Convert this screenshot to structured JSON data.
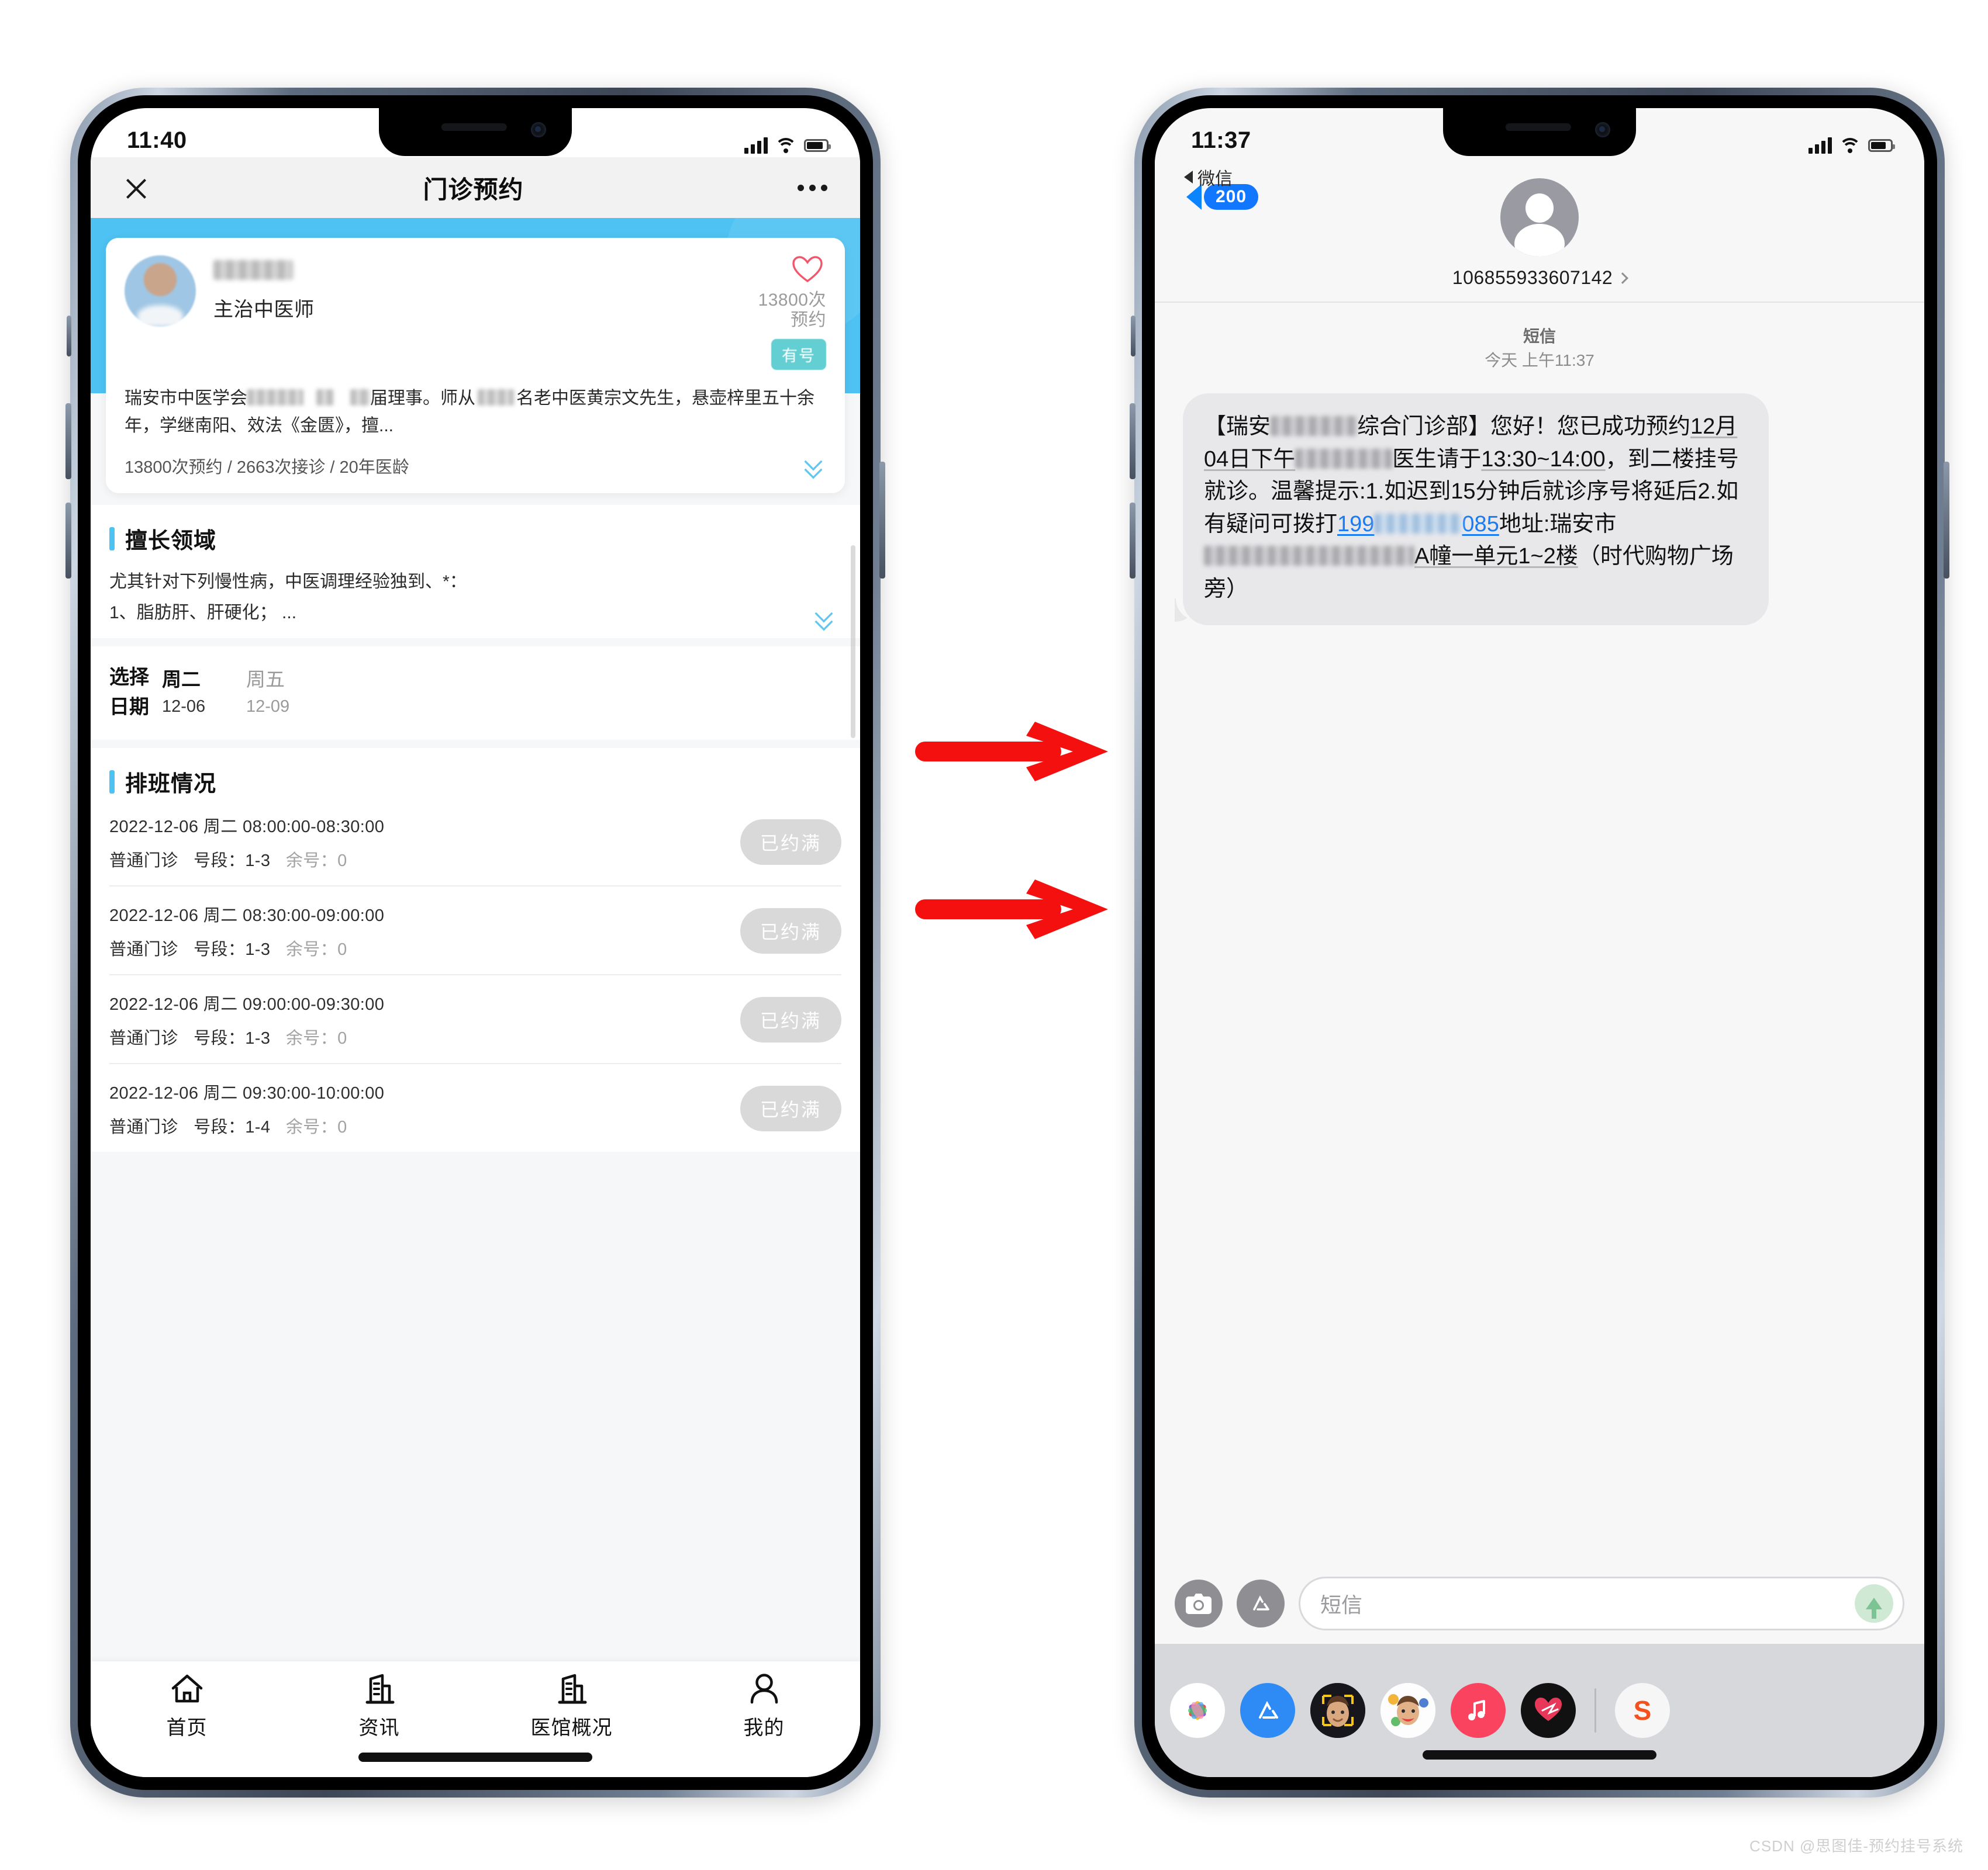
{
  "left_phone": {
    "status": {
      "time": "11:40"
    },
    "nav": {
      "title": "门诊预约",
      "close_icon": "close-icon",
      "more_icon": "more-dots-icon"
    },
    "doctor": {
      "name_masked": "",
      "rank": "主治中医师",
      "booking_count": "13800次",
      "booking_label": "预约",
      "badge": "有号",
      "favorite_icon": "heart-icon",
      "desc_p1": "瑞安市中医学会",
      "desc_p2": "届理事。师从",
      "desc_p3": "名老中医黄宗文先生，悬壶梓里五十余年，学继南阳、效法《金匮》，擅...",
      "stats": "13800次预约 / 2663次接诊 / 20年医龄",
      "expand_icon": "chevron-double-down-icon"
    },
    "expertise": {
      "title": "擅长领域",
      "line1": "尤其针对下列慢性病，中医调理经验独到、*：",
      "line2": "1、脂肪肝、肝硬化； ...",
      "expand_icon": "chevron-double-down-icon"
    },
    "date_picker": {
      "label_line1": "选择",
      "label_line2": "日期",
      "options": [
        {
          "weekday": "周二",
          "date": "12-06",
          "selected": true
        },
        {
          "weekday": "周五",
          "date": "12-09",
          "selected": false
        }
      ]
    },
    "schedule": {
      "title": "排班情况",
      "rows": [
        {
          "line1": "2022-12-06  周二   08:00:00-08:30:00",
          "clinic": "普通门诊",
          "range_label": "号段：",
          "range": "1-3",
          "left_label": "余号：",
          "left": "0",
          "status": "已约满"
        },
        {
          "line1": "2022-12-06  周二   08:30:00-09:00:00",
          "clinic": "普通门诊",
          "range_label": "号段：",
          "range": "1-3",
          "left_label": "余号：",
          "left": "0",
          "status": "已约满"
        },
        {
          "line1": "2022-12-06  周二   09:00:00-09:30:00",
          "clinic": "普通门诊",
          "range_label": "号段：",
          "range": "1-3",
          "left_label": "余号：",
          "left": "0",
          "status": "已约满"
        },
        {
          "line1": "2022-12-06  周二   09:30:00-10:00:00",
          "clinic": "普通门诊",
          "range_label": "号段：",
          "range": "1-4",
          "left_label": "余号：",
          "left": "0",
          "status": "已约满"
        }
      ]
    },
    "tabbar": [
      {
        "label": "首页",
        "icon": "home-icon"
      },
      {
        "label": "资讯",
        "icon": "building-icon"
      },
      {
        "label": "医馆概况",
        "icon": "building-icon"
      },
      {
        "label": "我的",
        "icon": "person-icon"
      }
    ]
  },
  "right_phone": {
    "status": {
      "time": "11:37",
      "back_app": "微信"
    },
    "header": {
      "unread_count": "200",
      "contact_number": "106855933607142",
      "avatar_icon": "person-avatar-icon"
    },
    "conversation": {
      "channel": "短信",
      "timestamp": "今天 上午11:37",
      "message": {
        "seg1": "【瑞安",
        "seg2": "综合门诊部】您好！您已成功预约",
        "seg_date": "12月04日下午",
        "seg3": "医生请于",
        "seg_time": "13:30~14:00",
        "seg4": "，到二楼挂号就诊。温馨提示:1.如迟到15分钟后就诊序号将延后2.如有疑问可拨打",
        "phone_start": "199",
        "phone_end": "085",
        "seg5": "地址:瑞安市",
        "seg_building": "A幢",
        "seg_unit": "一单元1~2楼",
        "seg6": "（时代购物广场旁）"
      }
    },
    "input": {
      "placeholder": "短信",
      "camera_icon": "camera-icon",
      "appstore_icon": "app-store-icon",
      "send_icon": "send-arrow-icon"
    },
    "apptray": [
      {
        "name": "photos-app-icon"
      },
      {
        "name": "app-store-app-icon"
      },
      {
        "name": "memoji-app-icon"
      },
      {
        "name": "memoji-2-app-icon"
      },
      {
        "name": "music-app-icon"
      },
      {
        "name": "digital-touch-app-icon"
      },
      {
        "name": "sogou-app-icon"
      }
    ]
  },
  "annotations": {
    "arrow_color": "#f51010",
    "arrows": [
      {
        "name": "flow-arrow-top"
      },
      {
        "name": "flow-arrow-bottom"
      }
    ]
  },
  "watermark": {
    "text": "CSDN @思图佳-预约挂号系统"
  },
  "colors": {
    "brand_blue": "#4ec2f2",
    "badge_teal": "#64cfd2",
    "ios_blue": "#1177ff",
    "bubble_gray": "#e8e8ea",
    "disabled_gray": "#d9d9d9",
    "arrow_red": "#f51010"
  }
}
